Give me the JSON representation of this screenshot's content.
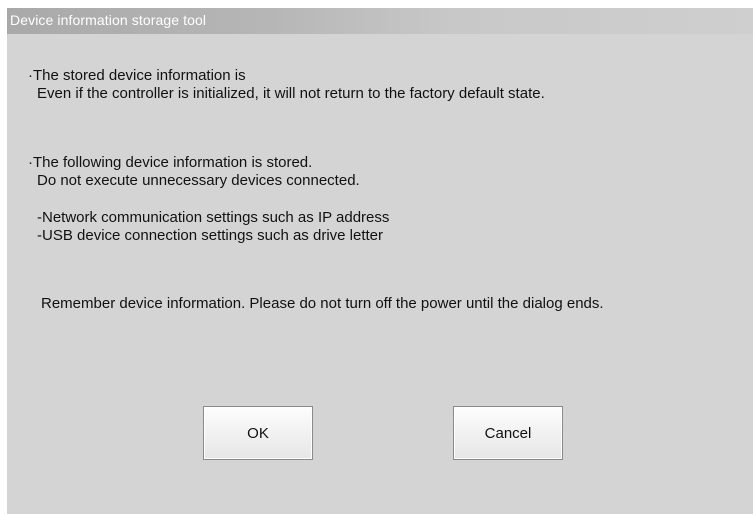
{
  "window": {
    "title": "Device information storage tool"
  },
  "message": {
    "section1": {
      "heading": "·The stored device information is",
      "detail": "Even if the controller is initialized, it will not return to the factory default state."
    },
    "section2": {
      "heading": "·The following device information is stored.",
      "detail": "Do not execute unnecessary devices connected.",
      "items": [
        "-Network communication settings such as IP address",
        "-USB device connection settings such as drive letter"
      ]
    },
    "notice": "Remember device information. Please do not turn off the power until the dialog ends."
  },
  "buttons": {
    "ok_label": "OK",
    "cancel_label": "Cancel"
  }
}
